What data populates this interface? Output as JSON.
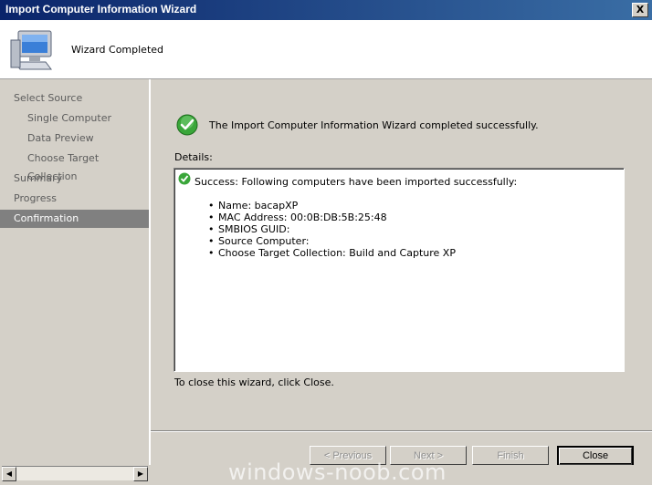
{
  "window": {
    "title": "Import Computer Information Wizard",
    "close_glyph": "X"
  },
  "header": {
    "title": "Wizard Completed",
    "icon": "computer-monitor-icon"
  },
  "nav": {
    "items": [
      {
        "label": "Select Source",
        "level": "top",
        "active": false
      },
      {
        "label": "Single Computer",
        "level": "sub",
        "active": false
      },
      {
        "label": "Data Preview",
        "level": "sub",
        "active": false
      },
      {
        "label": "Choose Target Collection",
        "level": "sub",
        "active": false
      },
      {
        "label": "Summary",
        "level": "top",
        "active": false
      },
      {
        "label": "Progress",
        "level": "top",
        "active": false
      },
      {
        "label": "Confirmation",
        "level": "top",
        "active": true
      }
    ]
  },
  "main": {
    "success_message": "The Import Computer Information Wizard completed successfully.",
    "details_label": "Details:",
    "details": {
      "heading": "Success: Following computers have been imported successfully:",
      "items": [
        "Name: bacapXP",
        "MAC Address: 00:0B:DB:5B:25:48",
        "SMBIOS GUID:",
        "Source Computer:",
        "Choose Target Collection: Build and Capture XP"
      ]
    },
    "close_hint": "To close this wizard, click Close."
  },
  "buttons": {
    "previous": "< Previous",
    "next": "Next >",
    "finish": "Finish",
    "close": "Close"
  },
  "watermark": "windows-noob.com",
  "colors": {
    "title_bar": "#0a246a",
    "selected_nav": "#808080",
    "success_green": "#3aa63a"
  }
}
